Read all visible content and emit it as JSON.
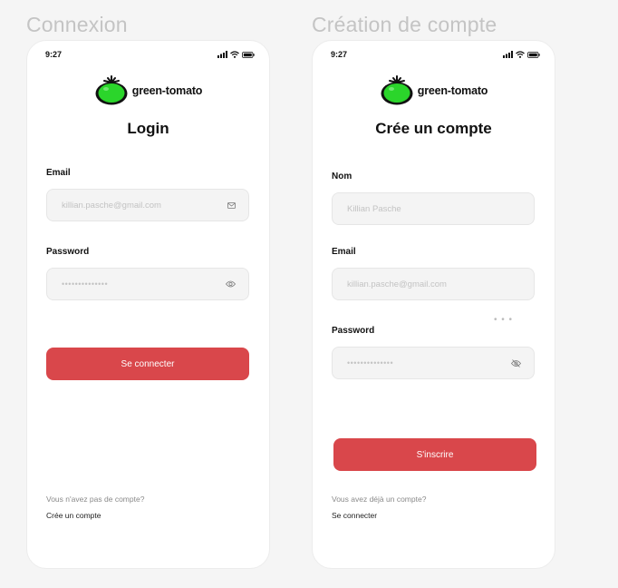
{
  "login_frame": {
    "frame_title": "Connexion",
    "status_time": "9:27",
    "logo_text": "green-tomato",
    "title": "Login",
    "email": {
      "label": "Email",
      "placeholder": "killian.pasche@gmail.com",
      "icon": "mail-icon"
    },
    "password": {
      "label": "Password",
      "value": "••••••••••••••",
      "icon": "eye-icon"
    },
    "submit_label": "Se connecter",
    "footer_prompt": "Vous n'avez pas de compte?",
    "footer_link": "Crée un compte"
  },
  "signup_frame": {
    "frame_title": "Création de compte",
    "status_time": "9:27",
    "logo_text": "green-tomato",
    "title": "Crée un compte",
    "name": {
      "label": "Nom",
      "placeholder": "Killian Pasche"
    },
    "email": {
      "label": "Email",
      "placeholder": "killian.pasche@gmail.com"
    },
    "password": {
      "label": "Password",
      "value": "••••••••••••••",
      "icon": "eye-off-icon"
    },
    "more_dots": "• • •",
    "submit_label": "S'inscrire",
    "footer_prompt": "Vous avez déjà un compte?",
    "footer_link": "Se connecter"
  },
  "colors": {
    "background": "#f5f5f5",
    "primary_button": "#d9474b",
    "tomato_green": "#2bd52b",
    "input_bg": "#f4f4f4"
  }
}
